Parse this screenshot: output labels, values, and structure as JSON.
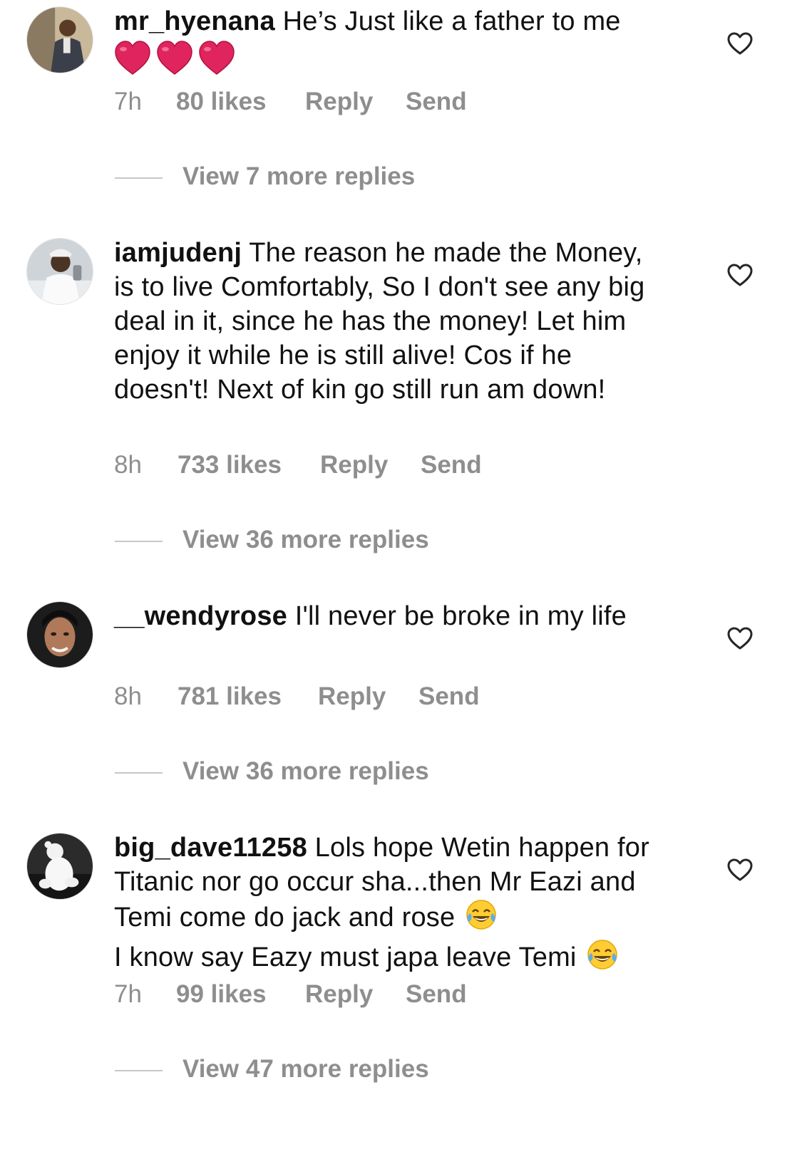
{
  "colors": {
    "text": "#111111",
    "muted": "#8e8e8e",
    "divider": "#c7c7c7",
    "heart_emoji": "#e0245e"
  },
  "comments": [
    {
      "username": "mr_hyenana",
      "text": "He’s Just like a father to me",
      "emoji": [
        "red-heart",
        "red-heart",
        "red-heart"
      ],
      "time": "7h",
      "likes": "80 likes",
      "reply": "Reply",
      "send": "Send",
      "view_replies": "View 7 more replies"
    },
    {
      "username": "iamjudenj",
      "text": "The reason he made the Money, is to live Comfortably, So I don't see any big deal in it, since he has the money! Let him enjoy it while he is still alive! Cos if he doesn't! Next of kin go still run am down!",
      "time": "8h",
      "likes": "733 likes",
      "reply": "Reply",
      "send": "Send",
      "view_replies": "View 36 more replies"
    },
    {
      "username": "__wendyrose",
      "text": "I'll never be broke in my life",
      "time": "8h",
      "likes": "781 likes",
      "reply": "Reply",
      "send": "Send",
      "view_replies": "View 36 more replies"
    },
    {
      "username": "big_dave11258",
      "text_line1": "Lols hope Wetin happen for Titanic nor go occur sha...then Mr Eazi and Temi come do jack and rose",
      "text_line2": "I know say Eazy must japa leave Temi",
      "emoji": [
        "face-with-tears-of-joy",
        "face-with-tears-of-joy"
      ],
      "time": "7h",
      "likes": "99 likes",
      "reply": "Reply",
      "send": "Send",
      "view_replies": "View 47 more replies"
    }
  ]
}
